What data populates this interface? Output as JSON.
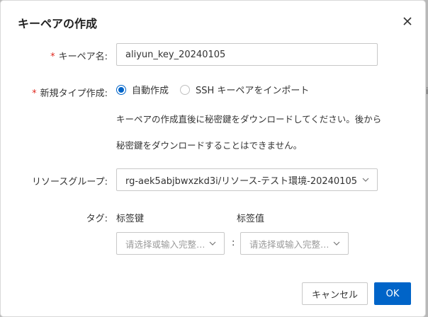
{
  "page_edge_text": "i",
  "dialog": {
    "title": "キーペアの作成",
    "close_icon": "close-icon"
  },
  "form": {
    "keypair_name": {
      "label": "キーペア名:",
      "required": "*",
      "value": "aliyun_key_20240105"
    },
    "creation_type": {
      "label": "新規タイプ作成:",
      "required": "*",
      "options": [
        {
          "label": "自動作成",
          "selected": true
        },
        {
          "label": "SSH キーペアをインポート",
          "selected": false
        }
      ],
      "help_line1": "キーペアの作成直後に秘密鍵をダウンロードしてください。後から",
      "help_line2": "秘密鍵をダウンロードすることはできません。"
    },
    "resource_group": {
      "label": "リソースグループ:",
      "value": "rg-aek5abjbwxzkd3i/リソース-テスト環境-20240105"
    },
    "tags": {
      "label": "タグ:",
      "key_header": "标签键",
      "value_header": "标签值",
      "key_placeholder": "请选择或输入完整…",
      "value_placeholder": "请选择或输入完整…",
      "separator": ":"
    }
  },
  "footer": {
    "cancel_label": "キャンセル",
    "ok_label": "OK"
  },
  "colors": {
    "primary": "#0064c8",
    "required": "#e0281e"
  }
}
